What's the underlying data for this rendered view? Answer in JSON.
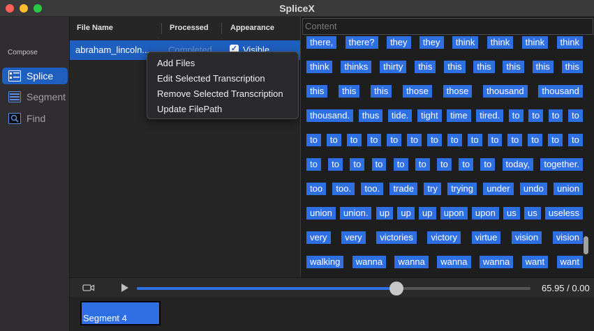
{
  "window": {
    "title": "SpliceX"
  },
  "sidebar": {
    "section_label": "Compose",
    "items": [
      {
        "label": "Splice",
        "icon": "splice-icon",
        "active": true
      },
      {
        "label": "Segment",
        "icon": "segment-icon",
        "active": false
      },
      {
        "label": "Find",
        "icon": "find-icon",
        "active": false
      }
    ]
  },
  "table": {
    "columns": [
      "File Name",
      "Processed",
      "Appearance"
    ],
    "rows": [
      {
        "file_name": "abraham_lincoln...",
        "processed": "Completed",
        "appearance": "Visible",
        "checked": true
      }
    ]
  },
  "context_menu": {
    "items": [
      "Add Files",
      "Edit Selected Transcription",
      "Remove Selected Transcription",
      "Update FilePath"
    ]
  },
  "content": {
    "placeholder": "Content",
    "word_rows": [
      [
        "there,",
        "there?",
        "they",
        "they",
        "think",
        "think",
        "think",
        "think"
      ],
      [
        "think",
        "thinks",
        "thirty",
        "this",
        "this",
        "this",
        "this",
        "this",
        "this"
      ],
      [
        "this",
        "this",
        "this",
        "those",
        "those",
        "thousand",
        "thousand"
      ],
      [
        "thousand.",
        "thus",
        "tide.",
        "tight",
        "time",
        "tired.",
        "to",
        "to",
        "to",
        "to"
      ],
      [
        "to",
        "to",
        "to",
        "to",
        "to",
        "to",
        "to",
        "to",
        "to",
        "to",
        "to",
        "to",
        "to",
        "to"
      ],
      [
        "to",
        "to",
        "to",
        "to",
        "to",
        "to",
        "to",
        "to",
        "to",
        "today,",
        "together."
      ],
      [
        "too",
        "too.",
        "too.",
        "trade",
        "try",
        "trying",
        "under",
        "undo",
        "union"
      ],
      [
        "union",
        "union.",
        "up",
        "up",
        "up",
        "upon",
        "upon",
        "us",
        "us",
        "useless"
      ],
      [
        "very",
        "very",
        "victories",
        "victory",
        "virtue",
        "vision",
        "vision"
      ],
      [
        "walking",
        "wanna",
        "wanna",
        "wanna",
        "wanna",
        "want",
        "want"
      ]
    ]
  },
  "player": {
    "time_display": "65.95 / 0.00",
    "progress_fraction": 0.66
  },
  "segments": [
    {
      "label": "Segment 4"
    }
  ],
  "colors": {
    "accent": "#2f6fe4",
    "selection": "#1f5fbf"
  }
}
